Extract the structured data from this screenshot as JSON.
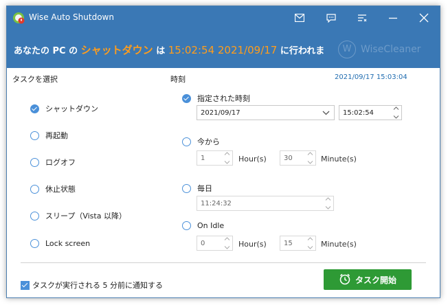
{
  "window": {
    "title": "Wise Auto Shutdown"
  },
  "banner": {
    "prefix": "あなたの PC の",
    "action": "シャットダウン",
    "wa": "は",
    "time": "15:02:54 2021/09/17",
    "suffix": "に行われま",
    "brand": "WiseCleaner",
    "brand_logo_letter": "W"
  },
  "tasks": {
    "title": "タスクを選択",
    "options": [
      {
        "label": "シャットダウン",
        "checked": true
      },
      {
        "label": "再起動",
        "checked": false
      },
      {
        "label": "ログオフ",
        "checked": false
      },
      {
        "label": "休止状態",
        "checked": false
      },
      {
        "label": "スリープ（Vista 以降）",
        "checked": false
      },
      {
        "label": "Lock screen",
        "checked": false
      }
    ]
  },
  "timing": {
    "title": "時刻",
    "now": "2021/09/17 15:03:04",
    "specified": {
      "label": "指定された時刻",
      "checked": true,
      "date": "2021/09/17",
      "time": "15:02:54"
    },
    "from_now": {
      "label": "今から",
      "checked": false,
      "hours": "1",
      "minutes": "30",
      "hour_unit": "Hour(s)",
      "minute_unit": "Minute(s)"
    },
    "daily": {
      "label": "毎日",
      "checked": false,
      "time": "11:24:32"
    },
    "on_idle": {
      "label": "On Idle",
      "checked": false,
      "hours": "0",
      "minutes": "15",
      "hour_unit": "Hour(s)",
      "minute_unit": "Minute(s)"
    }
  },
  "footer": {
    "notify_label": "タスクが実行される 5 分前に通知する",
    "notify_checked": true,
    "start_label": "タスク開始"
  },
  "colors": {
    "titlebar": "#3a78b5",
    "accent": "#ff9d1c",
    "radio": "#4a90d9",
    "start_button": "#2e9a35",
    "link": "#1f6cb0"
  },
  "icons": {
    "titlebar": [
      "mail-icon",
      "feedback-icon",
      "menu-icon",
      "minimize-icon",
      "close-icon"
    ],
    "start": "alarm-clock-icon"
  }
}
